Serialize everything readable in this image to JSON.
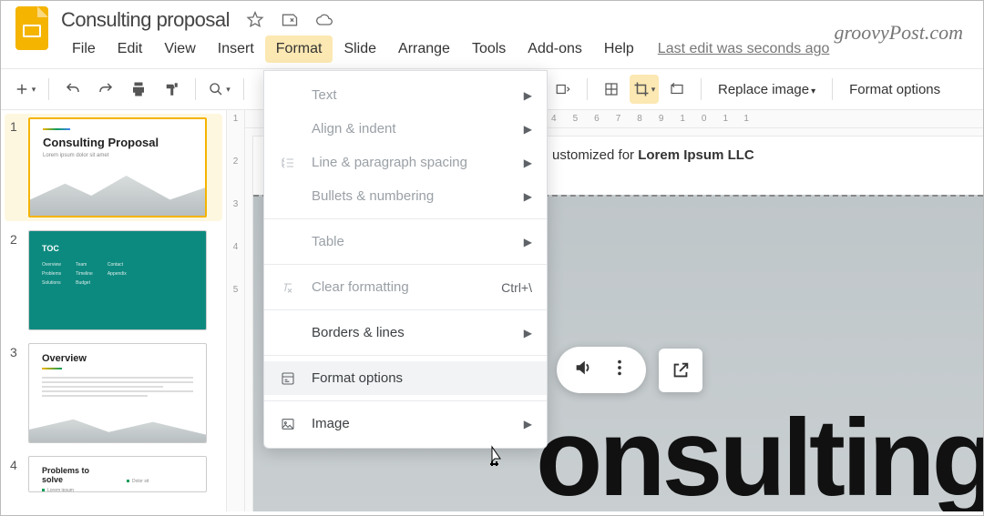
{
  "doc_title": "Consulting proposal",
  "watermark": "groovyPost.com",
  "menus": [
    "File",
    "Edit",
    "View",
    "Insert",
    "Format",
    "Slide",
    "Arrange",
    "Tools",
    "Add-ons",
    "Help"
  ],
  "active_menu": "Format",
  "last_edit": "Last edit was seconds ago",
  "toolbar": {
    "replace_image": "Replace image",
    "format_options": "Format options"
  },
  "ruler_h": [
    "4",
    "5",
    "6",
    "7",
    "8",
    "9",
    "10",
    "11"
  ],
  "ruler_v": [
    "1",
    "2",
    "3",
    "4",
    "5"
  ],
  "thumbs": {
    "t1": {
      "num": "1",
      "title": "Consulting Proposal",
      "sub": "Lorem ipsum dolor sit amet"
    },
    "t2": {
      "num": "2",
      "title": "TOC"
    },
    "t3": {
      "num": "3",
      "title": "Overview"
    },
    "t4": {
      "num": "4",
      "title": "Problems to solve"
    }
  },
  "canvas": {
    "line_prefix": "ustomized for ",
    "line_bold": "Lorem Ipsum LLC",
    "hero": "onsulting"
  },
  "dropdown": {
    "text": "Text",
    "align": "Align & indent",
    "spacing": "Line & paragraph spacing",
    "bullets": "Bullets & numbering",
    "table": "Table",
    "clear": "Clear formatting",
    "clear_sc": "Ctrl+\\",
    "borders": "Borders & lines",
    "format_opts": "Format options",
    "image": "Image"
  }
}
